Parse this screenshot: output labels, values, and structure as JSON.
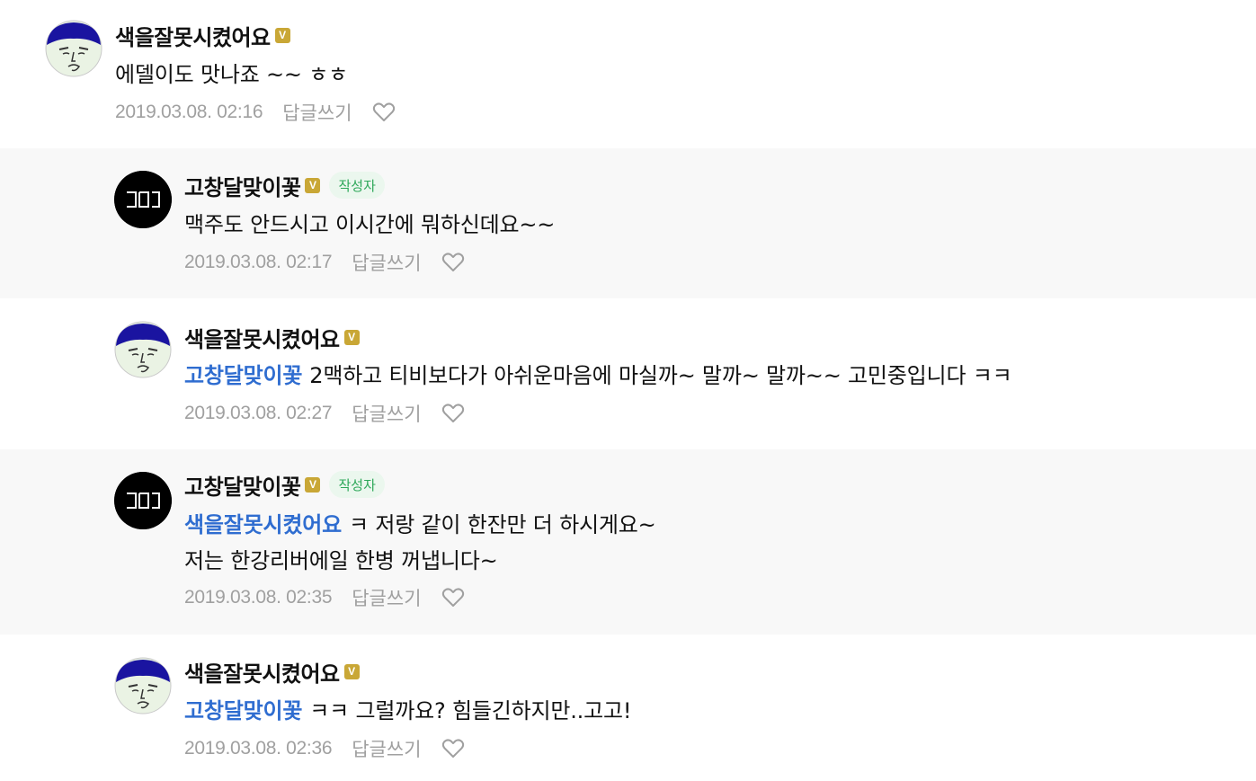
{
  "comments": [
    {
      "nickname": "색을잘못시켰어요",
      "badge": "V",
      "text": "에델이도 맛나죠 ~~ ㅎㅎ",
      "date": "2019.03.08. 02:16",
      "reply_label": "답글쓰기"
    },
    {
      "nickname": "고창달맞이꽃",
      "badge": "V",
      "author_tag": "작성자",
      "text": "맥주도 안드시고 이시간에 뭐하신데요~~",
      "date": "2019.03.08. 02:17",
      "reply_label": "답글쓰기",
      "avatar_text": "ᄀᄃ"
    },
    {
      "nickname": "색을잘못시켰어요",
      "badge": "V",
      "mention": "고창달맞이꽃",
      "text": "2맥하고 티비보다가 아쉬운마음에 마실까~ 말까~ 말까~~ 고민중입니다 ㅋㅋ",
      "date": "2019.03.08. 02:27",
      "reply_label": "답글쓰기"
    },
    {
      "nickname": "고창달맞이꽃",
      "badge": "V",
      "author_tag": "작성자",
      "mention": "색을잘못시켰어요",
      "text": "ㅋ 저랑 같이 한잔만 더 하시게요~",
      "text2": "저는 한강리버에일 한병 꺼냅니다~",
      "date": "2019.03.08. 02:35",
      "reply_label": "답글쓰기"
    },
    {
      "nickname": "색을잘못시켰어요",
      "badge": "V",
      "mention": "고창달맞이꽃",
      "text": "ㅋㅋ 그럴까요? 힘들긴하지만..고고!",
      "date": "2019.03.08. 02:36",
      "reply_label": "답글쓰기"
    }
  ],
  "colors": {
    "mention": "#2f6dd0",
    "badge": "#c9a736",
    "author_tag_bg": "#ebf7ee",
    "author_tag_text": "#2fa85a",
    "meta": "#a0a0a0",
    "reply_bg": "#f8f8f8"
  }
}
